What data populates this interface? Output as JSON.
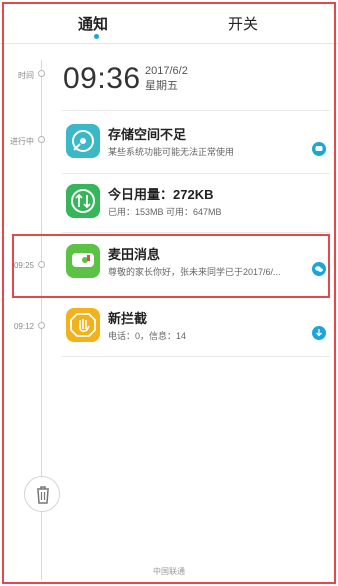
{
  "tabs": {
    "notify_label": "通知",
    "switch_label": "开关"
  },
  "timeline_labels": {
    "time": "时间",
    "ongoing": "进行中",
    "t1": "09:25",
    "t2": "09:12"
  },
  "clock": {
    "time": "09:36",
    "date": "2017/6/2",
    "weekday": "星期五"
  },
  "cards": [
    {
      "title": "存储空间不足",
      "text": "某些系统功能可能无法正常使用",
      "icon": "storage-icon"
    },
    {
      "title": "今日用量：272KB",
      "text": "已用：153MB 可用：647MB",
      "icon": "data-usage-icon"
    },
    {
      "title": "麦田消息",
      "text": "尊敬的家长你好，张未来同学已于2017/6/...",
      "icon": "chat-app-icon"
    },
    {
      "title": "新拦截",
      "text": "电话：0，信息：14",
      "icon": "block-hand-icon"
    }
  ],
  "footer": {
    "carrier": "中国联通"
  },
  "colors": {
    "accent": "#1aa6d6",
    "highlight": "#e04a4a",
    "storage": "#3ab8c8",
    "usage": "#36b55a",
    "chat": "#5cc245",
    "block": "#f2b21b"
  }
}
